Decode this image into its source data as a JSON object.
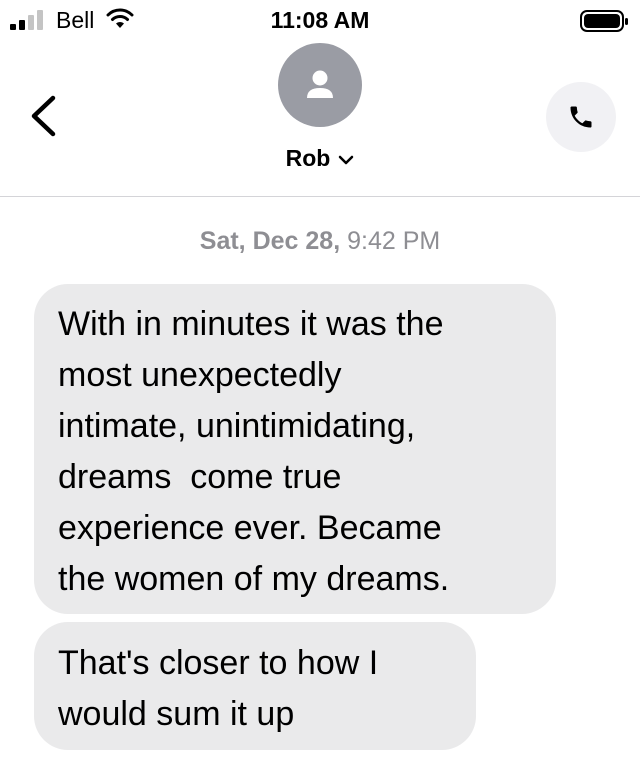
{
  "status_bar": {
    "carrier": "Bell",
    "time": "11:08 AM",
    "signal_bars": 2,
    "icons": [
      "signal-icon",
      "wifi-icon",
      "battery-icon"
    ]
  },
  "header": {
    "contact_name": "Rob",
    "back_icon": "chevron-left-icon",
    "call_icon": "phone-icon",
    "avatar_icon": "person-icon"
  },
  "conversation": {
    "timestamp_date": "Sat, Dec 28,",
    "timestamp_time": "9:42 PM",
    "messages": [
      {
        "text": "With in minutes it was the\nmost unexpectedly\nintimate, unintimidating,\ndreams  come true\nexperience ever. Became\nthe women of my dreams."
      },
      {
        "text": "That's closer to how I\nwould sum it up"
      }
    ]
  },
  "colors": {
    "bubble_received": "#eaeaeb",
    "timestamp": "#8e8e93",
    "avatar_bg": "#9a9ca4",
    "divider": "#d4d4d8"
  }
}
